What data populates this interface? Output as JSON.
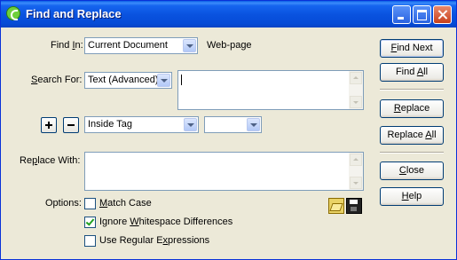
{
  "window": {
    "title": "Find and Replace"
  },
  "find_in": {
    "label": "Find In:",
    "mnemonic": "I",
    "value": "Current Document",
    "scope_text": "Web-page"
  },
  "search_for": {
    "label": "Search For:",
    "mnemonic": "S",
    "type": "Text (Advanced)",
    "value": ""
  },
  "tag_row": {
    "condition": "Inside Tag",
    "tag": ""
  },
  "replace_with": {
    "label": "Replace With:",
    "mnemonic": "p",
    "value": ""
  },
  "options": {
    "label": "Options:",
    "match_case": {
      "label": "Match Case",
      "checked": false
    },
    "ignore_whitespace": {
      "label": "Ignore Whitespace Differences",
      "checked": true
    },
    "regex": {
      "label": "Use Regular Expressions",
      "checked": false
    }
  },
  "buttons": {
    "find_next": "Find Next",
    "find_all": "Find All",
    "replace": "Replace",
    "replace_all": "Replace All",
    "close": "Close",
    "help": "Help"
  },
  "icons": [
    "app-icon",
    "minimize-icon",
    "maximize-icon",
    "close-icon",
    "plus-icon",
    "minus-icon",
    "folder-open-icon",
    "save-icon",
    "chevron-down-icon",
    "scroll-up-icon",
    "scroll-down-icon",
    "checkmark-icon"
  ]
}
